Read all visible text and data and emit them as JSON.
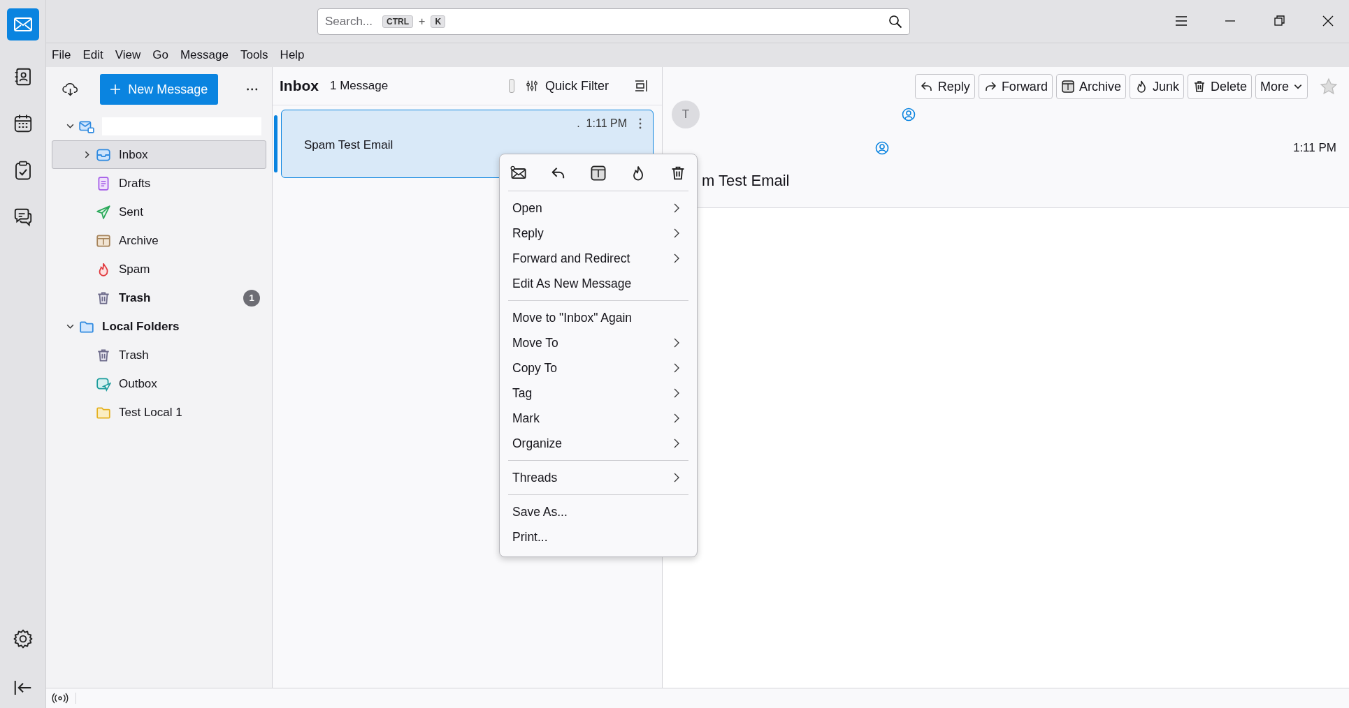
{
  "search": {
    "placeholder": "Search...",
    "keys": [
      "CTRL",
      "K"
    ],
    "joiner": "+"
  },
  "menubar": [
    {
      "label": "File"
    },
    {
      "label": "Edit"
    },
    {
      "label": "View"
    },
    {
      "label": "Go"
    },
    {
      "label": "Message"
    },
    {
      "label": "Tools"
    },
    {
      "label": "Help"
    }
  ],
  "folder_pane": {
    "new_message": "New Message",
    "tree": [
      {
        "kind": "account",
        "redacted": true,
        "expanded": true,
        "selected": false,
        "children": [
          {
            "kind": "inbox",
            "label": "Inbox",
            "expanded": false,
            "selected": true
          },
          {
            "kind": "drafts",
            "label": "Drafts",
            "selected": false
          },
          {
            "kind": "sent",
            "label": "Sent",
            "selected": false
          },
          {
            "kind": "archive",
            "label": "Archive",
            "selected": false
          },
          {
            "kind": "spam",
            "label": "Spam",
            "selected": false
          },
          {
            "kind": "trash",
            "label": "Trash",
            "unread": "1",
            "selected": false
          }
        ]
      },
      {
        "kind": "local",
        "label": "Local Folders",
        "expanded": true,
        "selected": false,
        "children": [
          {
            "kind": "trash",
            "label": "Trash",
            "selected": false
          },
          {
            "kind": "outbox",
            "label": "Outbox",
            "selected": false
          },
          {
            "kind": "folder",
            "label": "Test Local 1",
            "selected": false
          }
        ]
      }
    ]
  },
  "message_list": {
    "title": "Inbox",
    "count": "1 Message",
    "quick_filter": "Quick Filter",
    "quick_filter_pinned": false,
    "messages": [
      {
        "subject": "Spam Test Email",
        "separator": ".",
        "time": "1:11 PM",
        "selected": true
      }
    ]
  },
  "context_menu": {
    "toolbar": [
      {
        "kind": "open"
      },
      {
        "kind": "reply"
      },
      {
        "kind": "archive"
      },
      {
        "kind": "junk"
      },
      {
        "kind": "delete"
      }
    ],
    "groups": [
      [
        {
          "label": "Open",
          "submenu": true
        },
        {
          "label": "Reply",
          "submenu": true
        },
        {
          "label": "Forward and Redirect",
          "submenu": true
        },
        {
          "label": "Edit As New Message",
          "submenu": false
        }
      ],
      [
        {
          "label": "Move to \"Inbox\" Again",
          "submenu": false
        },
        {
          "label": "Move To",
          "submenu": true
        },
        {
          "label": "Copy To",
          "submenu": true
        },
        {
          "label": "Tag",
          "submenu": true
        },
        {
          "label": "Mark",
          "submenu": true
        },
        {
          "label": "Organize",
          "submenu": true
        }
      ],
      [
        {
          "label": "Threads",
          "submenu": true
        }
      ],
      [
        {
          "label": "Save As...",
          "submenu": false
        },
        {
          "label": "Print...",
          "submenu": false
        }
      ]
    ]
  },
  "reader": {
    "buttons": [
      {
        "kind": "reply",
        "label": "Reply"
      },
      {
        "kind": "forward",
        "label": "Forward"
      },
      {
        "kind": "archive",
        "label": "Archive"
      },
      {
        "kind": "junk",
        "label": "Junk"
      },
      {
        "kind": "delete",
        "label": "Delete"
      },
      {
        "kind": "more",
        "label": "More"
      }
    ],
    "starred": false,
    "avatar": "T",
    "time": "1:11 PM",
    "subject": "m Test Email"
  }
}
